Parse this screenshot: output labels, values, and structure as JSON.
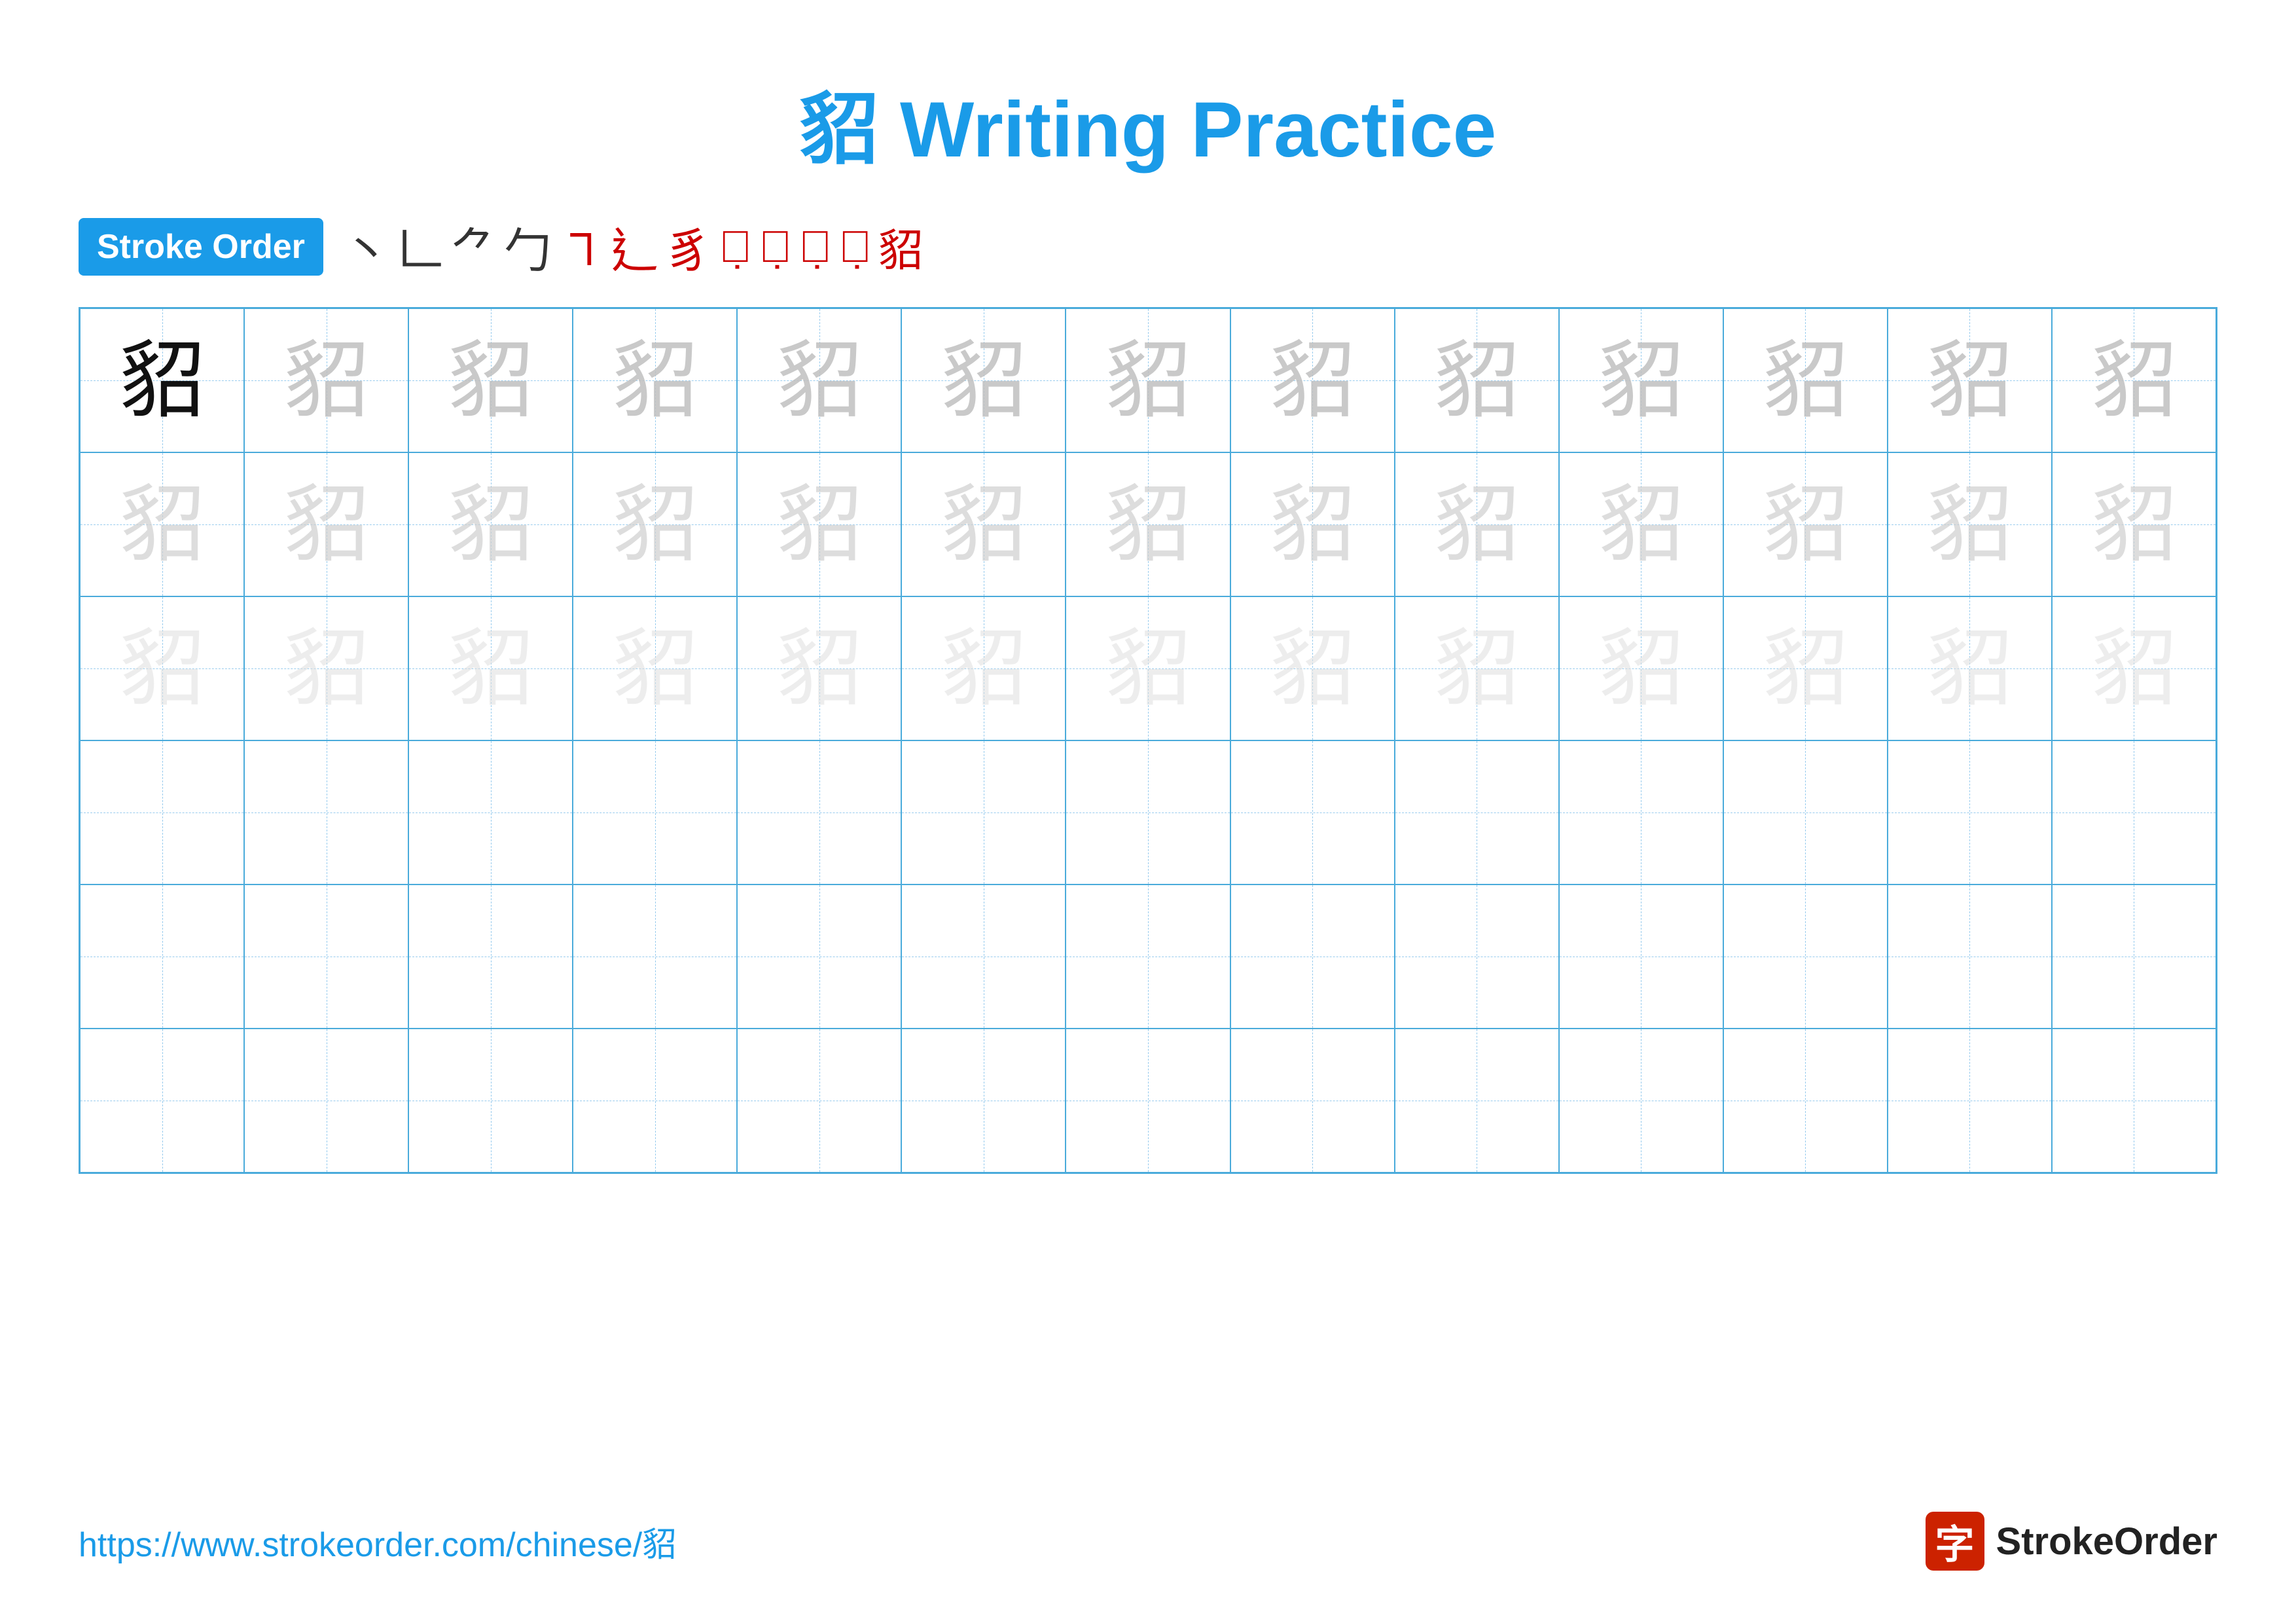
{
  "title": {
    "text": "貂 Writing Practice",
    "color": "#1a9be8"
  },
  "stroke_order": {
    "badge_label": "Stroke Order",
    "strokes": [
      "丶",
      "㇀",
      "㇀",
      "㇁",
      "㇕",
      "㇕",
      "㇕",
      "貂⁻",
      "貂⁻",
      "貂⁻",
      "貂⁻",
      "貂"
    ]
  },
  "character": "貂",
  "grid": {
    "rows": 6,
    "cols": 13
  },
  "footer": {
    "url": "https://www.strokeorder.com/chinese/貂",
    "logo_text": "StrokeOrder",
    "logo_icon": "字"
  }
}
